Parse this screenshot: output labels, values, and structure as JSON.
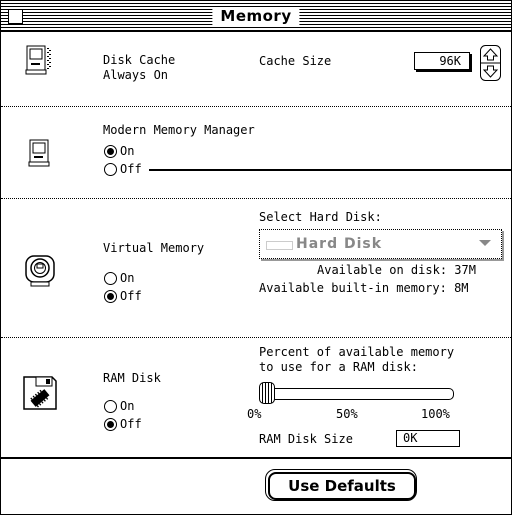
{
  "window": {
    "title": "Memory"
  },
  "disk_cache": {
    "label_line1": "Disk Cache",
    "label_line2": "Always On",
    "cache_size_label": "Cache Size",
    "cache_size_value": "96K"
  },
  "modern_memory": {
    "label": "Modern Memory Manager",
    "on_label": "On",
    "off_label": "Off",
    "selected": "On"
  },
  "virtual_memory": {
    "label": "Virtual Memory",
    "select_disk_label": "Select Hard Disk:",
    "selected_disk": "Hard Disk",
    "available_on_disk_label": "Available on disk:",
    "available_on_disk_value": "37M",
    "available_builtin_label": "Available built-in memory:",
    "available_builtin_value": "8M",
    "on_label": "On",
    "off_label": "Off",
    "selected": "Off"
  },
  "ram_disk": {
    "label": "RAM Disk",
    "percent_label_line1": "Percent of available memory",
    "percent_label_line2": "to use for a RAM disk:",
    "slider_min": "0%",
    "slider_mid": "50%",
    "slider_max": "100%",
    "slider_value_percent": 0,
    "size_label": "RAM Disk Size",
    "size_value": "0K",
    "on_label": "On",
    "off_label": "Off",
    "selected": "Off"
  },
  "footer": {
    "use_defaults_label": "Use Defaults"
  },
  "icons": [
    "close-box-icon",
    "disk-cache-computer-icon",
    "modern-memory-computer-icon",
    "virtual-memory-disk-icon",
    "ram-disk-chip-icon",
    "arrows-stepper-icon",
    "dropdown-arrow-icon"
  ]
}
